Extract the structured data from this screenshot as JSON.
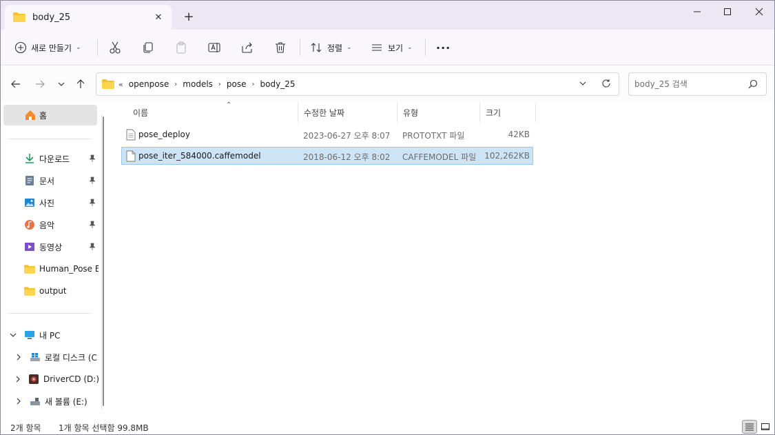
{
  "window": {
    "tab_title": "body_25",
    "tab_close": "✕",
    "new_tab": "+",
    "minimize": "─",
    "maximize": "☐",
    "close": "✕"
  },
  "toolbar": {
    "new_label": "새로 만들기",
    "sort_label": "정렬",
    "view_label": "보기",
    "more_label": "···"
  },
  "address": {
    "overflow": "«",
    "crumbs": [
      "openpose",
      "models",
      "pose",
      "body_25"
    ],
    "search_placeholder": "body_25 검색"
  },
  "nav": {
    "home": "홈",
    "quick": [
      {
        "label": "다운로드",
        "icon": "download-icon",
        "pinned": true
      },
      {
        "label": "문서",
        "icon": "documents-icon",
        "pinned": true
      },
      {
        "label": "사진",
        "icon": "pictures-icon",
        "pinned": true
      },
      {
        "label": "음악",
        "icon": "music-icon",
        "pinned": true
      },
      {
        "label": "동영상",
        "icon": "videos-icon",
        "pinned": true
      }
    ],
    "folders": [
      "Human_Pose Es",
      "output"
    ],
    "this_pc": "내 PC",
    "drives": [
      "로컬 디스크 (C",
      "DriverCD (D:)",
      "새 볼륨 (E:)"
    ]
  },
  "columns": {
    "name": "이름",
    "modified": "수정한 날짜",
    "type": "유형",
    "size": "크기"
  },
  "files": [
    {
      "name": "pose_deploy",
      "modified": "2023-06-27 오후 8:07",
      "type": "PROTOTXT 파일",
      "size": "42KB",
      "selected": false
    },
    {
      "name": "pose_iter_584000.caffemodel",
      "modified": "2018-06-12 오후 8:02",
      "type": "CAFFEMODEL 파일",
      "size": "102,262KB",
      "selected": true
    }
  ],
  "status": {
    "count": "2개 항목",
    "selection": "1개 항목 선택함 99.8MB"
  },
  "colors": {
    "accent": "#0067c0",
    "selection_bg": "#cde4f7",
    "folder": "#f5c22e"
  }
}
